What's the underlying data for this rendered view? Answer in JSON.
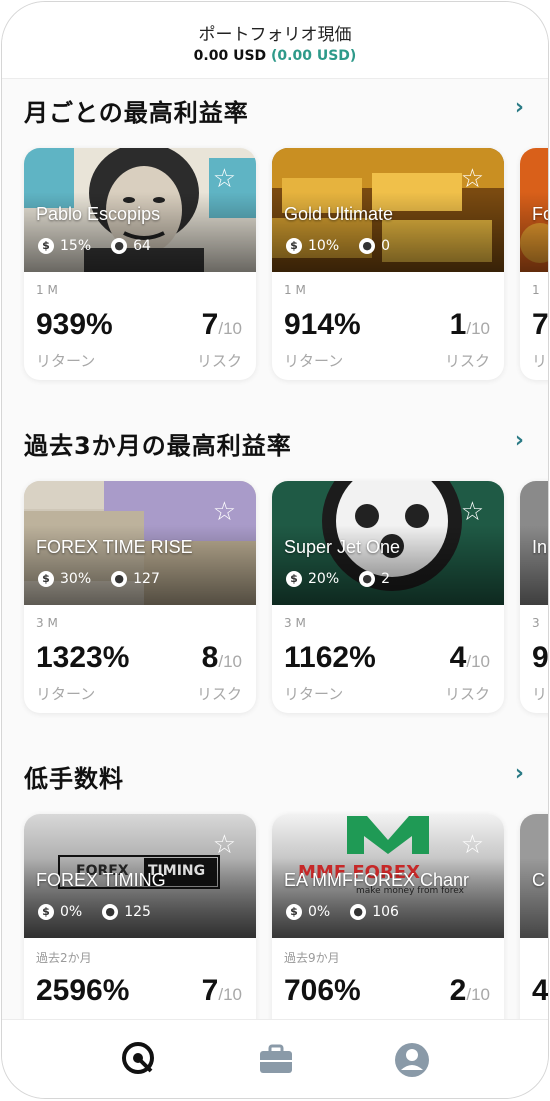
{
  "header": {
    "title": "ポートフォリオ現価",
    "value": "0.00 USD",
    "change": "(0.00 USD)"
  },
  "sections": [
    {
      "title": "月ごとの最高利益率",
      "cards": [
        {
          "name": "Pablo Escopips",
          "pct": "15%",
          "users": "64",
          "period": "1 M",
          "return": "939%",
          "return_label": "リターン",
          "risk": "7",
          "risk_den": "/10",
          "risk_label": "リスク",
          "image": "portrait"
        },
        {
          "name": "Gold Ultimate",
          "pct": "10%",
          "users": "0",
          "period": "1 M",
          "return": "914%",
          "return_label": "リターン",
          "risk": "1",
          "risk_den": "/10",
          "risk_label": "リスク",
          "image": "gold"
        },
        {
          "name": "Fo",
          "pct": "",
          "users": "",
          "period": "1",
          "return": "7",
          "return_label": "リ",
          "risk": "",
          "risk_den": "",
          "risk_label": "",
          "image": "fire"
        }
      ]
    },
    {
      "title": "過去3か月の最高利益率",
      "cards": [
        {
          "name": "FOREX TIME RISE",
          "pct": "30%",
          "users": "127",
          "period": "3 M",
          "return": "1323%",
          "return_label": "リターン",
          "risk": "8",
          "risk_den": "/10",
          "risk_label": "リスク",
          "image": "money"
        },
        {
          "name": "Super Jet One",
          "pct": "20%",
          "users": "2",
          "period": "3 M",
          "return": "1162%",
          "return_label": "リターン",
          "risk": "4",
          "risk_den": "/10",
          "risk_label": "リスク",
          "image": "watch"
        },
        {
          "name": "In",
          "pct": "",
          "users": "",
          "period": "3",
          "return": "9",
          "return_label": "リ",
          "risk": "",
          "risk_den": "",
          "risk_label": "",
          "image": "grey"
        }
      ]
    },
    {
      "title": "低手数料",
      "cards": [
        {
          "name": "FOREX TIMING",
          "pct": "0%",
          "users": "125",
          "period": "過去2か月",
          "return": "2596%",
          "return_label": "",
          "risk": "7",
          "risk_den": "/10",
          "risk_label": "",
          "image": "grey"
        },
        {
          "name": "EA MMFFOREX Chanr",
          "pct": "0%",
          "users": "106",
          "period": "過去9か月",
          "return": "706%",
          "return_label": "",
          "risk": "2",
          "risk_den": "/10",
          "risk_label": "",
          "image": "mmf"
        },
        {
          "name": "C",
          "pct": "",
          "users": "",
          "period": "",
          "return": "4",
          "return_label": "",
          "risk": "",
          "risk_den": "",
          "risk_label": "",
          "image": "grey"
        }
      ]
    }
  ],
  "logos": {
    "forex_timing_a": "FOREX",
    "forex_timing_b": "TIMING",
    "mmf_main": "MMF FOREX",
    "mmf_sub": "make money from forex"
  },
  "icons": {
    "more": "chevron-right-icon",
    "favorite": "star-outline-icon",
    "fee": "dollar-icon",
    "users": "user-icon",
    "nav": [
      "discover-icon",
      "briefcase-icon",
      "account-icon"
    ]
  },
  "colors": {
    "accent": "#2a7a85",
    "positive": "#2e9a8a"
  }
}
